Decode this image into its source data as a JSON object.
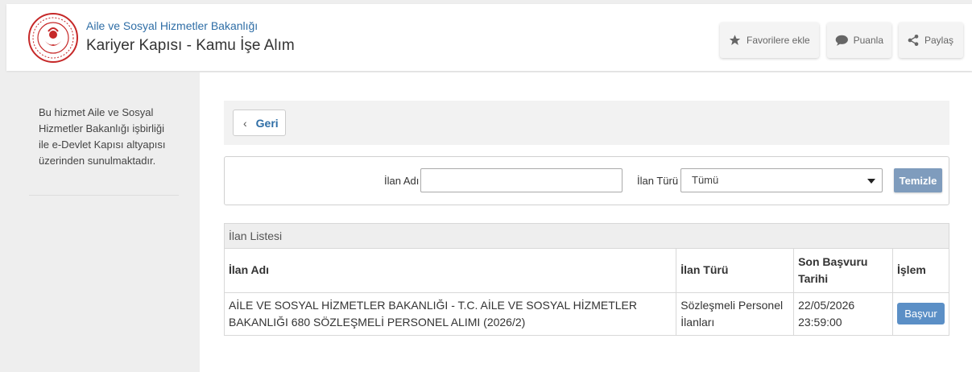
{
  "header": {
    "ministry": "Aile ve Sosyal Hizmetler Bakanlığı",
    "title": "Kariyer Kapısı - Kamu İşe Alım",
    "buttons": {
      "favorite": "Favorilere ekle",
      "rate": "Puanla",
      "share": "Paylaş"
    }
  },
  "sidebar": {
    "info": "Bu hizmet Aile ve Sosyal Hizmetler Bakanlığı işbirliği ile e-Devlet Kapısı altyapısı üzerinden sunulmaktadır."
  },
  "back_button": "Geri",
  "filter": {
    "name_label": "İlan Adı",
    "name_value": "",
    "type_label": "İlan Türü",
    "type_value": "Tümü",
    "clear_button": "Temizle"
  },
  "list": {
    "title": "İlan Listesi",
    "columns": [
      "İlan Adı",
      "İlan Türü",
      "Son Başvuru Tarihi",
      "İşlem"
    ],
    "rows": [
      {
        "name": "AİLE VE SOSYAL HİZMETLER BAKANLIĞI - T.C. AİLE VE SOSYAL HİZMETLER BAKANLIĞI 680 SÖZLEŞMELİ PERSONEL ALIMI (2026/2)",
        "type": "Sözleşmeli Personel İlanları",
        "deadline": "22/05/2026 23:59:00",
        "action": "Başvur"
      }
    ]
  }
}
